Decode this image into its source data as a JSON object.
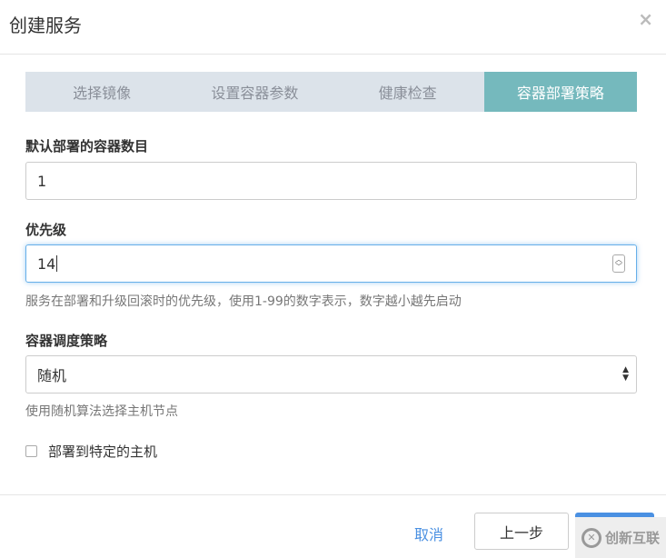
{
  "dialog": {
    "title": "创建服务"
  },
  "steps": [
    "选择镜像",
    "设置容器参数",
    "健康检查",
    "容器部署策略"
  ],
  "form": {
    "count_label": "默认部署的容器数目",
    "count_value": "1",
    "priority_label": "优先级",
    "priority_value": "14",
    "priority_help": "服务在部署和升级回滚时的优先级，使用1-99的数字表示，数字越小越先启动",
    "strategy_label": "容器调度策略",
    "strategy_value": "随机",
    "strategy_help": "使用随机算法选择主机节点",
    "specific_host_label": "部署到特定的主机"
  },
  "footer": {
    "cancel": "取消",
    "prev": "上一步"
  },
  "watermark": "创新互联"
}
